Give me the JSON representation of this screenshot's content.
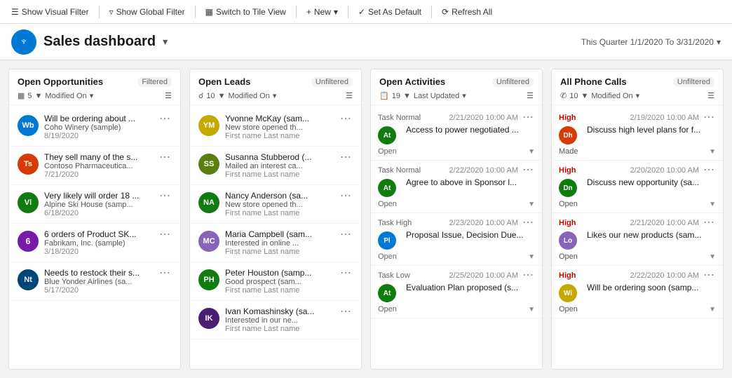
{
  "toolbar": {
    "show_visual_filter": "Show Visual Filter",
    "show_global_filter": "Show Global Filter",
    "switch_to_tile_view": "Switch to Tile View",
    "new": "New",
    "set_as_default": "Set As Default",
    "refresh_all": "Refresh All"
  },
  "header": {
    "title": "Sales dashboard",
    "period": "This Quarter 1/1/2020 To 3/31/2020"
  },
  "panels": {
    "opportunities": {
      "title": "Open Opportunities",
      "status": "Filtered",
      "count": "5",
      "sort": "Modified On",
      "items": [
        {
          "initials": "Wb",
          "color": "#0078d4",
          "title": "Will be ordering about ...",
          "subtitle": "Coho Winery (sample)",
          "date": "8/19/2020"
        },
        {
          "initials": "Ts",
          "color": "#d83b01",
          "title": "They sell many of the s...",
          "subtitle": "Contoso Pharmaceutica...",
          "date": "7/21/2020"
        },
        {
          "initials": "Vl",
          "color": "#107c10",
          "title": "Very likely will order 18 ...",
          "subtitle": "Alpine Ski House (samp...",
          "date": "6/18/2020"
        },
        {
          "initials": "6",
          "color": "#7719aa",
          "is_number": true,
          "title": "6 orders of Product SK...",
          "subtitle": "Fabrikam, Inc. (sample)",
          "date": "3/18/2020"
        },
        {
          "initials": "Nt",
          "color": "#004578",
          "title": "Needs to restock their s...",
          "subtitle": "Blue Yonder Airlines (sa...",
          "date": "5/17/2020"
        }
      ]
    },
    "leads": {
      "title": "Open Leads",
      "status": "Unfiltered",
      "count": "10",
      "sort": "Modified On",
      "items": [
        {
          "initials": "YM",
          "color": "#c7a800",
          "title": "Yvonne McKay (sam...",
          "subtitle": "New store opened th...",
          "meta": "First name Last name"
        },
        {
          "initials": "SS",
          "color": "#5c7e10",
          "title": "Susanna Stubberod (...",
          "subtitle": "Mailed an interest ca...",
          "meta": "First name Last name"
        },
        {
          "initials": "NA",
          "color": "#107c10",
          "title": "Nancy Anderson (sa...",
          "subtitle": "New store opened th...",
          "meta": "First name Last name"
        },
        {
          "initials": "MC",
          "color": "#8764b8",
          "title": "Maria Campbell (sam...",
          "subtitle": "Interested in online ...",
          "meta": "First name Last name"
        },
        {
          "initials": "PH",
          "color": "#107c10",
          "title": "Peter Houston (samp...",
          "subtitle": "Good prospect (sam...",
          "meta": "First name Last name"
        },
        {
          "initials": "IK",
          "color": "#4b1d70",
          "title": "Ivan Komashinsky (sa...",
          "subtitle": "Interested in our ne...",
          "meta": "First name Last name"
        }
      ]
    },
    "activities": {
      "title": "Open Activities",
      "status": "Unfiltered",
      "count": "19",
      "sort": "Last Updated",
      "items": [
        {
          "type": "Task Normal",
          "date": "2/21/2020 10:00 AM",
          "initials": "At",
          "color": "#107c10",
          "title": "Access to power negotiated ...",
          "status": "Open"
        },
        {
          "type": "Task Normal",
          "date": "2/22/2020 10:00 AM",
          "initials": "At",
          "color": "#107c10",
          "title": "Agree to above in Sponsor l...",
          "status": "Open"
        },
        {
          "type": "Task High",
          "date": "2/23/2020 10:00 AM",
          "initials": "Pl",
          "color": "#0078d4",
          "title": "Proposal Issue, Decision Due...",
          "status": "Open"
        },
        {
          "type": "Task Low",
          "date": "2/25/2020 10:00 AM",
          "initials": "At",
          "color": "#107c10",
          "title": "Evaluation Plan proposed (s...",
          "status": "Open"
        }
      ]
    },
    "phonecalls": {
      "title": "All Phone Calls",
      "status": "Unfiltered",
      "count": "10",
      "sort": "Modified On",
      "items": [
        {
          "priority": "High",
          "date": "2/19/2020 10:00 AM",
          "initials": "Dh",
          "color": "#d83b01",
          "title": "Discuss high level plans for f...",
          "status": "Made"
        },
        {
          "priority": "High",
          "date": "2/20/2020 10:00 AM",
          "initials": "Dn",
          "color": "#107c10",
          "title": "Discuss new opportunity (sa...",
          "status": "Open"
        },
        {
          "priority": "High",
          "date": "2/21/2020 10:00 AM",
          "initials": "Lo",
          "color": "#8764b8",
          "title": "Likes our new products (sam...",
          "status": "Open"
        },
        {
          "priority": "High",
          "date": "2/22/2020 10:00 AM",
          "initials": "Wi",
          "color": "#c7a800",
          "title": "Will be ordering soon (samp...",
          "status": "Open"
        }
      ]
    }
  }
}
